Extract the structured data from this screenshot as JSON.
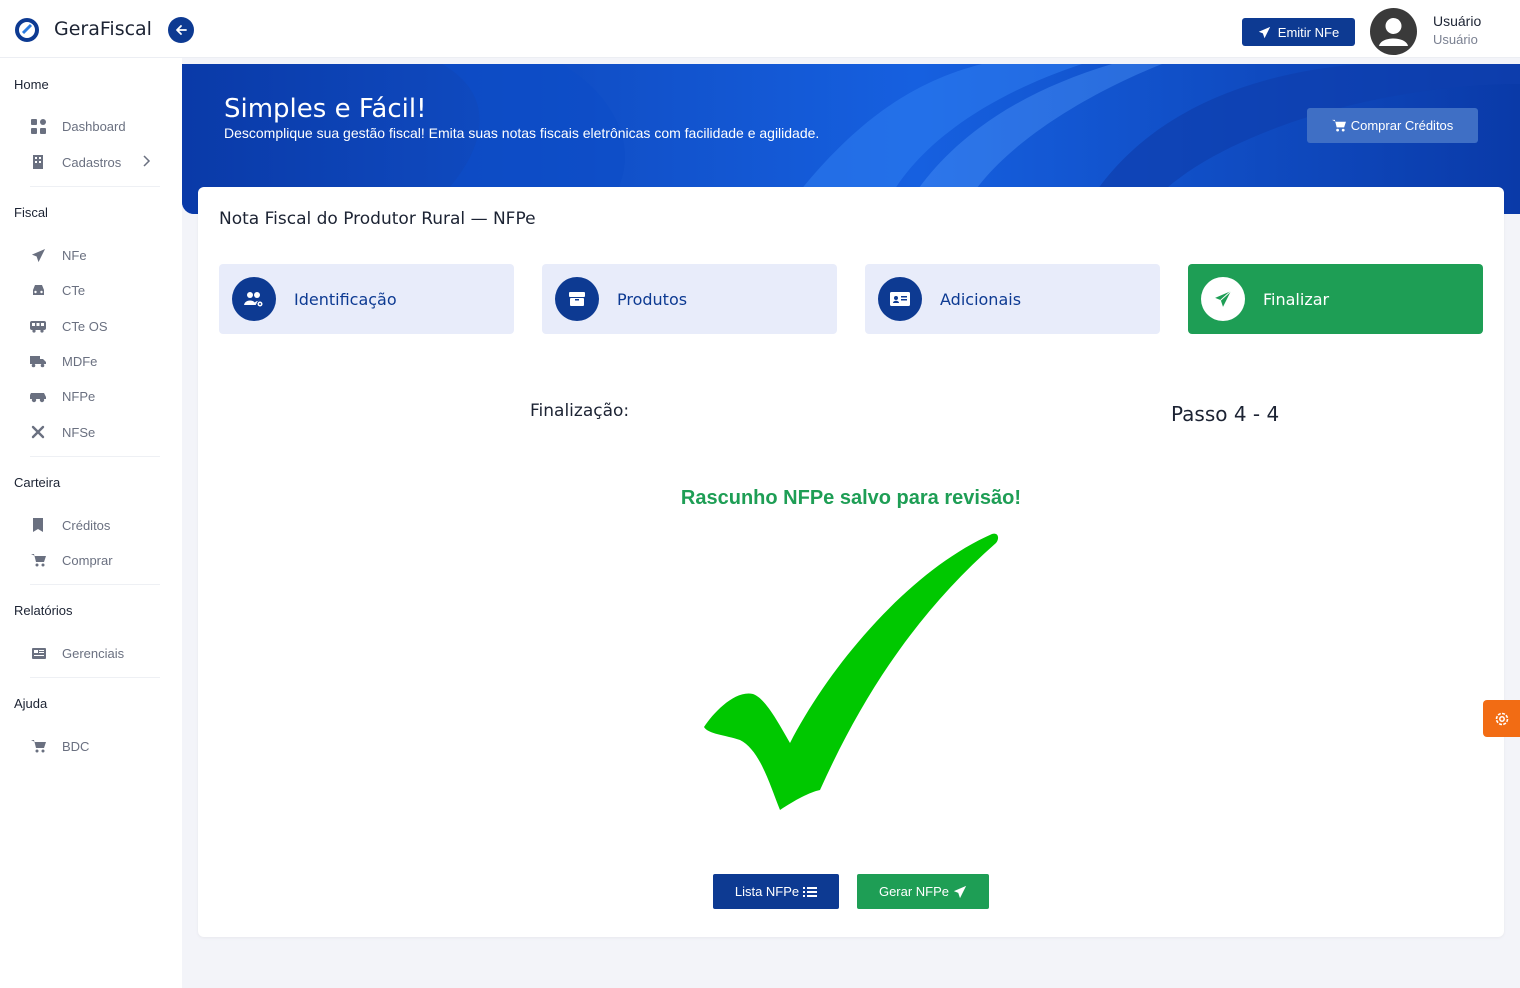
{
  "app": {
    "brand": "GeraFiscal"
  },
  "header": {
    "emit_label": "Emitir NFe",
    "user_name": "Usuário",
    "user_role": "Usuário"
  },
  "sidebar": {
    "sections": [
      {
        "title": "Home",
        "items": [
          {
            "label": "Dashboard",
            "icon": "dashboard-icon"
          },
          {
            "label": "Cadastros",
            "icon": "building-icon",
            "has_submenu": true
          }
        ]
      },
      {
        "title": "Fiscal",
        "items": [
          {
            "label": "NFe",
            "icon": "paper-plane-icon"
          },
          {
            "label": "CTe",
            "icon": "car-icon"
          },
          {
            "label": "CTe OS",
            "icon": "bus-icon"
          },
          {
            "label": "MDFe",
            "icon": "truck-icon"
          },
          {
            "label": "NFPe",
            "icon": "tractor-icon"
          },
          {
            "label": "NFSe",
            "icon": "tools-icon"
          }
        ]
      },
      {
        "title": "Carteira",
        "items": [
          {
            "label": "Créditos",
            "icon": "receipt-icon"
          },
          {
            "label": "Comprar",
            "icon": "cart-icon"
          }
        ]
      },
      {
        "title": "Relatórios",
        "items": [
          {
            "label": "Gerenciais",
            "icon": "newspaper-icon"
          }
        ]
      },
      {
        "title": "Ajuda",
        "items": [
          {
            "label": "BDC",
            "icon": "cart-icon"
          }
        ]
      }
    ]
  },
  "hero": {
    "title": "Simples e Fácil!",
    "subtitle": "Descomplique sua gestão fiscal! Emita suas notas fiscais eletrônicas com facilidade e agilidade.",
    "buy_label": "Comprar Créditos"
  },
  "card": {
    "title": "Nota Fiscal do Produtor Rural — NFPe",
    "steps": [
      {
        "label": "Identificação",
        "icon": "users-cog-icon",
        "active": false
      },
      {
        "label": "Produtos",
        "icon": "box-icon",
        "active": false
      },
      {
        "label": "Adicionais",
        "icon": "id-card-icon",
        "active": false
      },
      {
        "label": "Finalizar",
        "icon": "paper-plane-icon",
        "active": true
      }
    ],
    "final_label": "Finalização:",
    "step_indicator": "Passo 4 - 4",
    "success_message": "Rascunho NFPe salvo para revisão!",
    "list_button": "Lista NFPe",
    "generate_button": "Gerar NFPe"
  },
  "colors": {
    "primary": "#0d3a92",
    "success": "#1e9e55",
    "check": "#00c800",
    "settings": "#f26c14"
  }
}
